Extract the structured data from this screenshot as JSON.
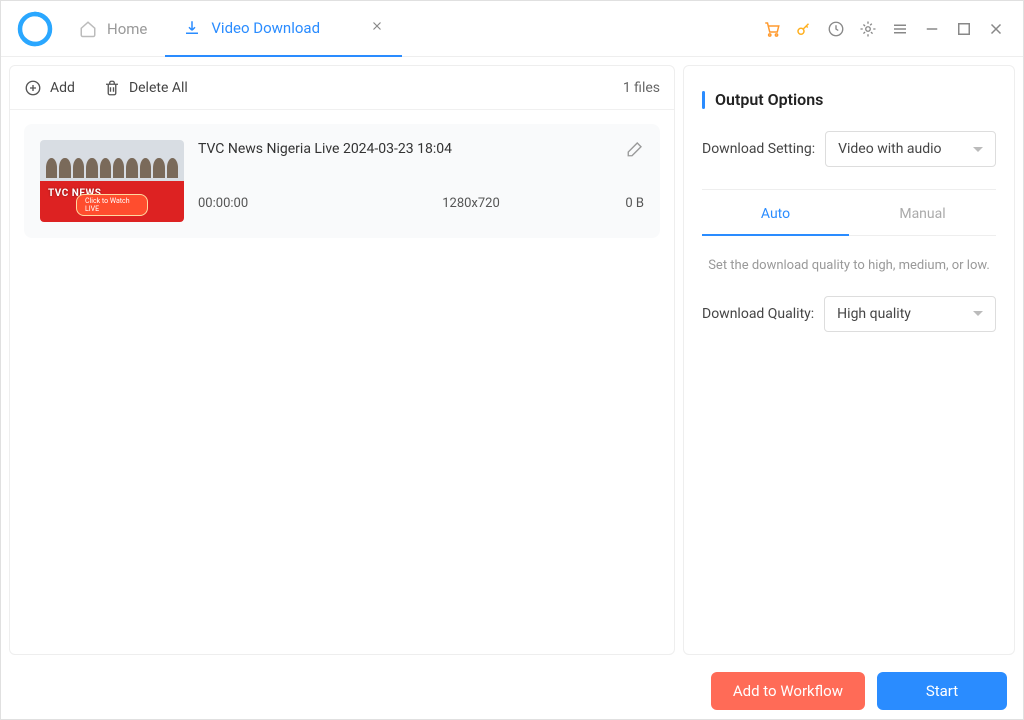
{
  "titlebar": {
    "home_label": "Home",
    "active_tab_label": "Video Download"
  },
  "toolbar": {
    "add_label": "Add",
    "delete_all_label": "Delete All",
    "file_count_text": "1 files"
  },
  "file": {
    "title": "TVC News Nigeria Live 2024-03-23 18:04",
    "duration": "00:00:00",
    "resolution": "1280x720",
    "size": "0 B",
    "thumb_brand": "TVC NEWS",
    "thumb_badge": "Click to Watch LIVE"
  },
  "output": {
    "section_title": "Output Options",
    "download_setting_label": "Download Setting:",
    "download_setting_value": "Video with audio",
    "tab_auto": "Auto",
    "tab_manual": "Manual",
    "hint": "Set the download quality to high, medium, or low.",
    "download_quality_label": "Download Quality:",
    "download_quality_value": "High quality"
  },
  "footer": {
    "workflow_label": "Add to Workflow",
    "start_label": "Start"
  }
}
